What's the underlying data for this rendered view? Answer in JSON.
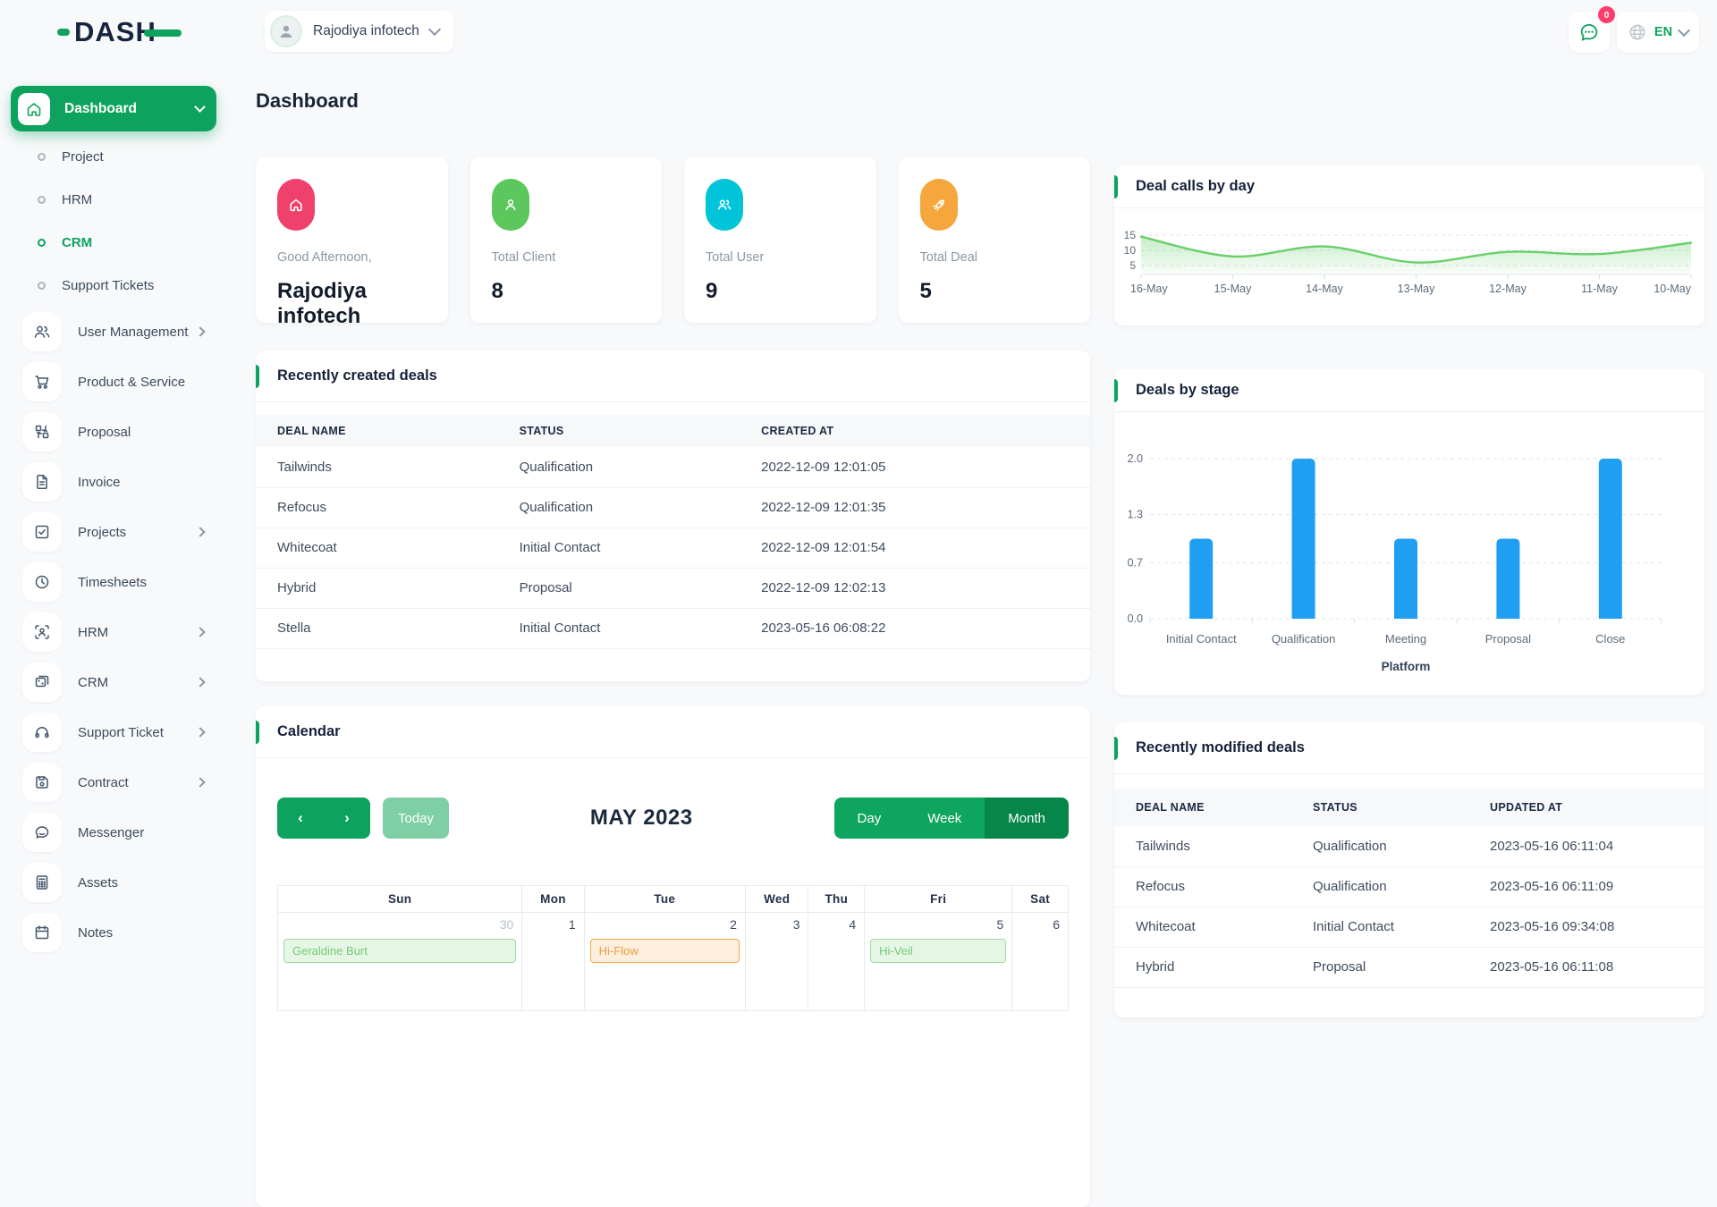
{
  "header": {
    "brand": "DASH",
    "company": "Rajodiya infotech",
    "notification_count": "0",
    "language": "EN",
    "page_title": "Dashboard"
  },
  "sidebar": {
    "dashboard_label": "Dashboard",
    "sub_items": [
      {
        "label": "Project"
      },
      {
        "label": "HRM"
      },
      {
        "label": "CRM",
        "active": true
      },
      {
        "label": "Support Tickets"
      }
    ],
    "items": [
      {
        "label": "User Management",
        "icon": "users-icon",
        "chevron": true
      },
      {
        "label": "Product & Service",
        "icon": "cart-icon"
      },
      {
        "label": "Proposal",
        "icon": "boxes-icon"
      },
      {
        "label": "Invoice",
        "icon": "file-icon"
      },
      {
        "label": "Projects",
        "icon": "check-square-icon",
        "chevron": true
      },
      {
        "label": "Timesheets",
        "icon": "clock-icon"
      },
      {
        "label": "HRM",
        "icon": "person-scan-icon",
        "chevron": true
      },
      {
        "label": "CRM",
        "icon": "cards-icon",
        "chevron": true
      },
      {
        "label": "Support Ticket",
        "icon": "headphones-icon",
        "chevron": true
      },
      {
        "label": "Contract",
        "icon": "save-icon",
        "chevron": true
      },
      {
        "label": "Messenger",
        "icon": "chat-icon"
      },
      {
        "label": "Assets",
        "icon": "calculator-icon"
      },
      {
        "label": "Notes",
        "icon": "calendar-icon"
      }
    ]
  },
  "stats": [
    {
      "label": "Good Afternoon,",
      "value": "Rajodiya infotech",
      "icon": "home-icon",
      "color": "#f0416c"
    },
    {
      "label": "Total Client",
      "value": "8",
      "icon": "user-icon",
      "color": "#5bc75d"
    },
    {
      "label": "Total User",
      "value": "9",
      "icon": "users-icon",
      "color": "#00c4d9"
    },
    {
      "label": "Total Deal",
      "value": "5",
      "icon": "rocket-icon",
      "color": "#f5a63c"
    }
  ],
  "chart_data": [
    {
      "id": "deal-calls",
      "type": "area",
      "title": "Deal calls by day",
      "x": [
        "16-May",
        "15-May",
        "14-May",
        "13-May",
        "12-May",
        "11-May",
        "10-May"
      ],
      "values": [
        14.5,
        8,
        11.3,
        6,
        9.5,
        8.8,
        12.5
      ],
      "yticks": [
        5,
        10,
        15
      ],
      "ylim": [
        4,
        16
      ],
      "grid": "dashed",
      "line_color": "#69cf6b",
      "fill_color": "#69cf6b"
    },
    {
      "id": "deals-by-stage",
      "type": "bar",
      "title": "Deals by stage",
      "categories": [
        "Initial Contact",
        "Qualification",
        "Meeting",
        "Proposal",
        "Close"
      ],
      "values": [
        1,
        2,
        1,
        1,
        2
      ],
      "yticks": [
        0.0,
        0.7,
        1.3,
        2.0
      ],
      "ytick_labels": [
        "0.0",
        "0.7",
        "1.3",
        "2.0"
      ],
      "ylim": [
        0,
        2
      ],
      "xlabel": "Platform",
      "grid": "dashed",
      "bar_color": "#1e9ff2"
    }
  ],
  "recent_created": {
    "title": "Recently created deals",
    "headers": [
      "DEAL NAME",
      "STATUS",
      "CREATED AT"
    ],
    "rows": [
      [
        "Tailwinds",
        "Qualification",
        "2022-12-09 12:01:05"
      ],
      [
        "Refocus",
        "Qualification",
        "2022-12-09 12:01:35"
      ],
      [
        "Whitecoat",
        "Initial Contact",
        "2022-12-09 12:01:54"
      ],
      [
        "Hybrid",
        "Proposal",
        "2022-12-09 12:02:13"
      ],
      [
        "Stella",
        "Initial Contact",
        "2023-05-16 06:08:22"
      ]
    ]
  },
  "recent_modified": {
    "title": "Recently modified deals",
    "headers": [
      "DEAL NAME",
      "STATUS",
      "UPDATED AT"
    ],
    "rows": [
      [
        "Tailwinds",
        "Qualification",
        "2023-05-16 06:11:04"
      ],
      [
        "Refocus",
        "Qualification",
        "2023-05-16 06:11:09"
      ],
      [
        "Whitecoat",
        "Initial Contact",
        "2023-05-16 09:34:08"
      ],
      [
        "Hybrid",
        "Proposal",
        "2023-05-16 06:11:08"
      ]
    ]
  },
  "calendar": {
    "title": "Calendar",
    "today_label": "Today",
    "month_title": "MAY 2023",
    "views": [
      "Day",
      "Week",
      "Month"
    ],
    "active_view": "Month",
    "weekdays": [
      "Sun",
      "Mon",
      "Tue",
      "Wed",
      "Thu",
      "Fri",
      "Sat"
    ],
    "days": [
      {
        "num": "30",
        "muted": true,
        "event": {
          "label": "Geraldine Burt",
          "color": "green"
        }
      },
      {
        "num": "1"
      },
      {
        "num": "2",
        "event": {
          "label": "Hi-Flow",
          "color": "orange"
        }
      },
      {
        "num": "3"
      },
      {
        "num": "4"
      },
      {
        "num": "5",
        "event": {
          "label": "Hi-Veil",
          "color": "green"
        }
      },
      {
        "num": "6"
      }
    ]
  },
  "colors": {
    "primary_green": "#0da35e",
    "dark_green": "#07864a",
    "light_green_button": "#7ecfa4",
    "badge_red": "#fd3c6b",
    "bar_blue": "#1e9ff2",
    "line_green": "#69cf6b",
    "event_green_bg": "#e6f6e4",
    "event_orange_bg": "#fdeedd"
  }
}
